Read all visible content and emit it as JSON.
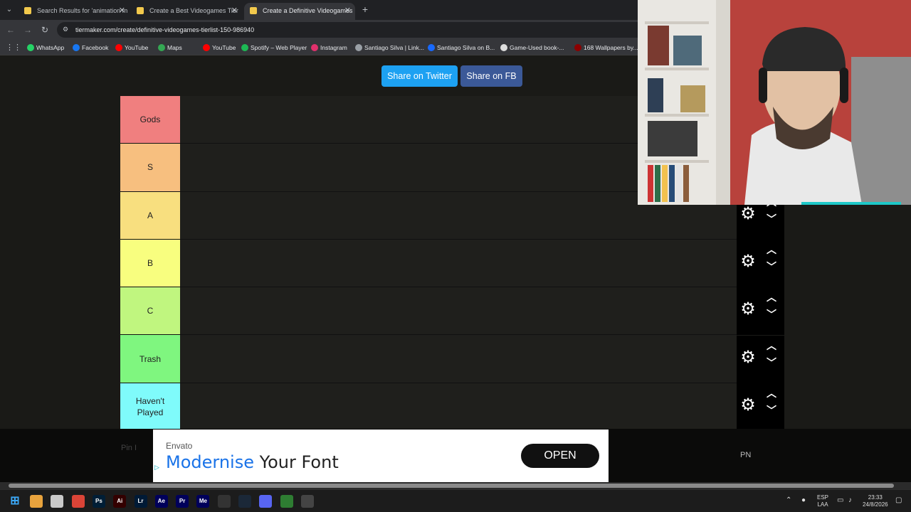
{
  "browser": {
    "tabs": [
      {
        "title": "Search Results for 'animation m"
      },
      {
        "title": "Create a Best Videogames Tier"
      },
      {
        "title": "Create a Definitive Videogames"
      }
    ],
    "url": "tiermaker.com/create/definitive-videogames-tierlist-150-986940",
    "bookmarks": [
      {
        "label": "WhatsApp",
        "color": "#25d366"
      },
      {
        "label": "Facebook",
        "color": "#1877f2"
      },
      {
        "label": "YouTube",
        "color": "#ff0000"
      },
      {
        "label": "Maps",
        "color": "#34a853"
      },
      {
        "label": "YouTube",
        "color": "#ff0000"
      },
      {
        "label": "Spotify – Web Player",
        "color": "#1db954"
      },
      {
        "label": "Instagram",
        "color": "#e1306c"
      },
      {
        "label": "Santiago Silva | Link...",
        "color": "#9aa0a6"
      },
      {
        "label": "Santiago Silva on B...",
        "color": "#1769ff"
      },
      {
        "label": "Game-Used book-...",
        "color": "#dddddd"
      },
      {
        "label": "168 Wallpapers by...",
        "color": "#8b0000"
      }
    ]
  },
  "share": {
    "twitter": "Share on Twitter",
    "fb": "Share on FB"
  },
  "tiers": [
    {
      "label": "Gods",
      "color": "#f07f7f"
    },
    {
      "label": "S",
      "color": "#f7bf7f"
    },
    {
      "label": "A",
      "color": "#f8df7f"
    },
    {
      "label": "B",
      "color": "#f8fe7f"
    },
    {
      "label": "C",
      "color": "#c0f67f"
    },
    {
      "label": "Trash",
      "color": "#7ff67f"
    },
    {
      "label": "Haven't Played",
      "color": "#7ffbfb"
    }
  ],
  "ad": {
    "brand": "Envato",
    "headline_highlight": "Modernise",
    "headline_rest": " Your Font",
    "cta": "OPEN"
  },
  "footer": {
    "pn": "PN",
    "pin": "Pin I"
  },
  "taskbar": {
    "apps": [
      {
        "label": "",
        "color": "#e8a33d"
      },
      {
        "label": "",
        "color": "#c9c9c9"
      },
      {
        "label": "",
        "color": "#db4437"
      },
      {
        "label": "Ps",
        "color": "#001e36"
      },
      {
        "label": "Ai",
        "color": "#330000"
      },
      {
        "label": "Lr",
        "color": "#001a36"
      },
      {
        "label": "Ae",
        "color": "#00005b"
      },
      {
        "label": "Pr",
        "color": "#00005b"
      },
      {
        "label": "Me",
        "color": "#00005b"
      },
      {
        "label": "",
        "color": "#333333"
      },
      {
        "label": "",
        "color": "#1b2838"
      },
      {
        "label": "",
        "color": "#5865f2"
      },
      {
        "label": "",
        "color": "#2e7d32"
      },
      {
        "label": "",
        "color": "#444444"
      }
    ],
    "lang": "ESP",
    "lang2": "LAA",
    "time": "23:33",
    "date": "24/8/2026"
  }
}
